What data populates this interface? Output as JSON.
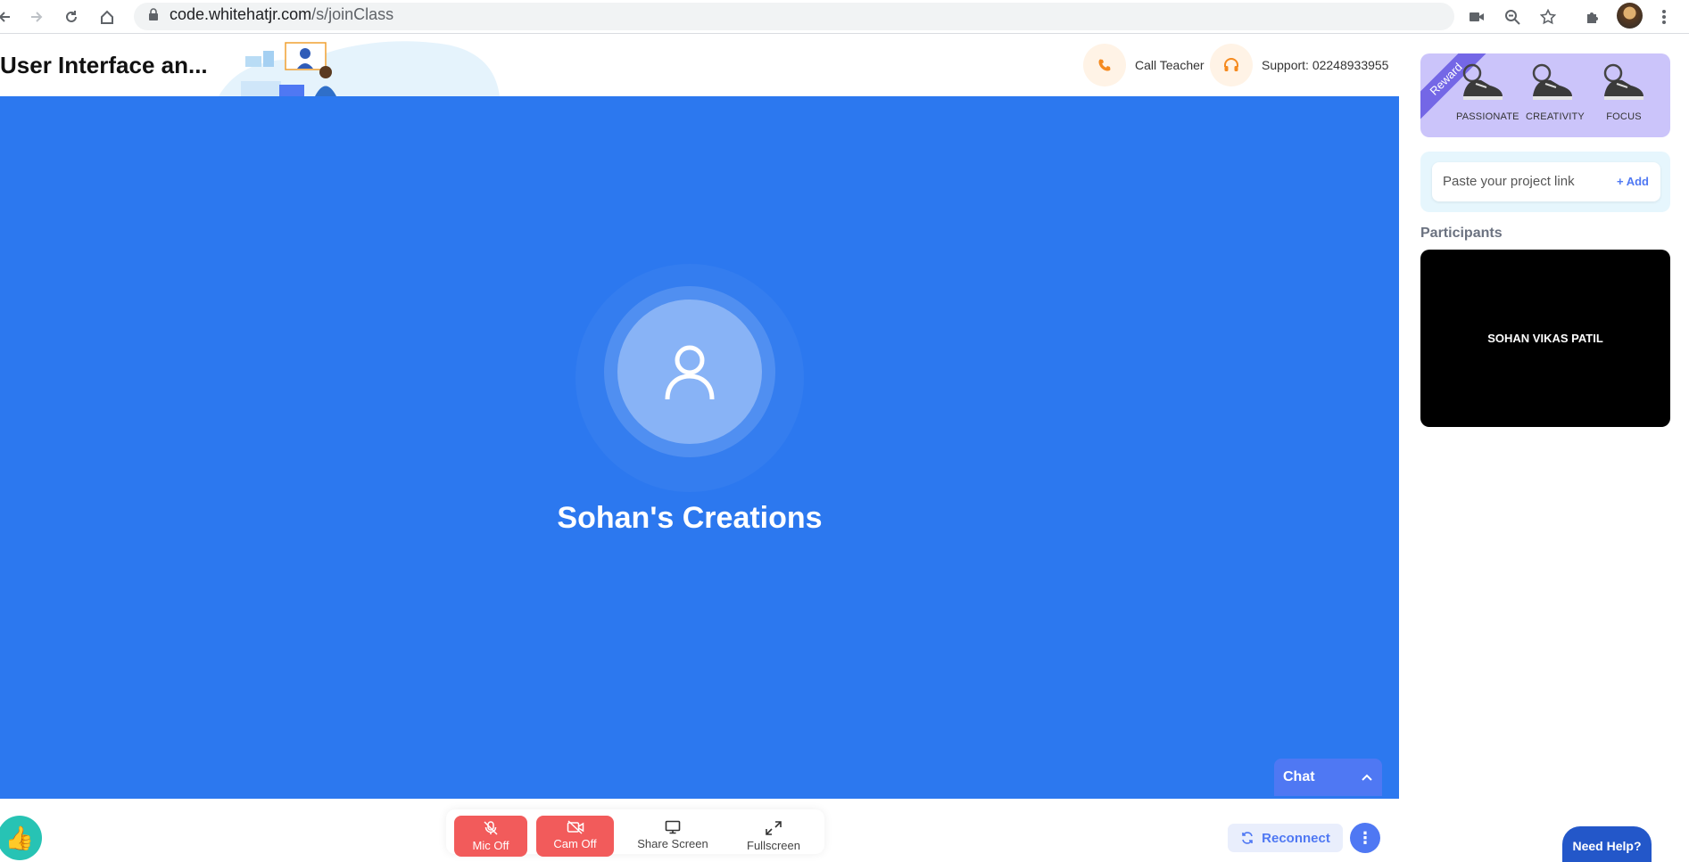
{
  "browser": {
    "url_host": "code.whitehatjr.com",
    "url_path": "/s/joinClass"
  },
  "header": {
    "class_title": "User Interface an...",
    "call_teacher_label": "Call Teacher",
    "support_label": "Support: 02248933955"
  },
  "video": {
    "title": "Sohan's Creations",
    "chat_label": "Chat"
  },
  "sidebar": {
    "reward_ribbon": "Reward",
    "badges": [
      {
        "label": "PASSIONATE"
      },
      {
        "label": "CREATIVITY"
      },
      {
        "label": "FOCUS"
      }
    ],
    "project_link_placeholder": "Paste your project link",
    "add_label": "+ Add",
    "participants_title": "Participants",
    "participant_name": "SOHAN VIKAS PATIL"
  },
  "controls": {
    "mic_label": "Mic Off",
    "cam_label": "Cam Off",
    "share_label": "Share Screen",
    "fullscreen_label": "Fullscreen",
    "reconnect_label": "Reconnect",
    "need_help_label": "Need Help?"
  },
  "colors": {
    "video_bg": "#2c78ef",
    "accent": "#4f78f3",
    "danger": "#f25b5b",
    "reward_bg": "#cbc4fa"
  }
}
